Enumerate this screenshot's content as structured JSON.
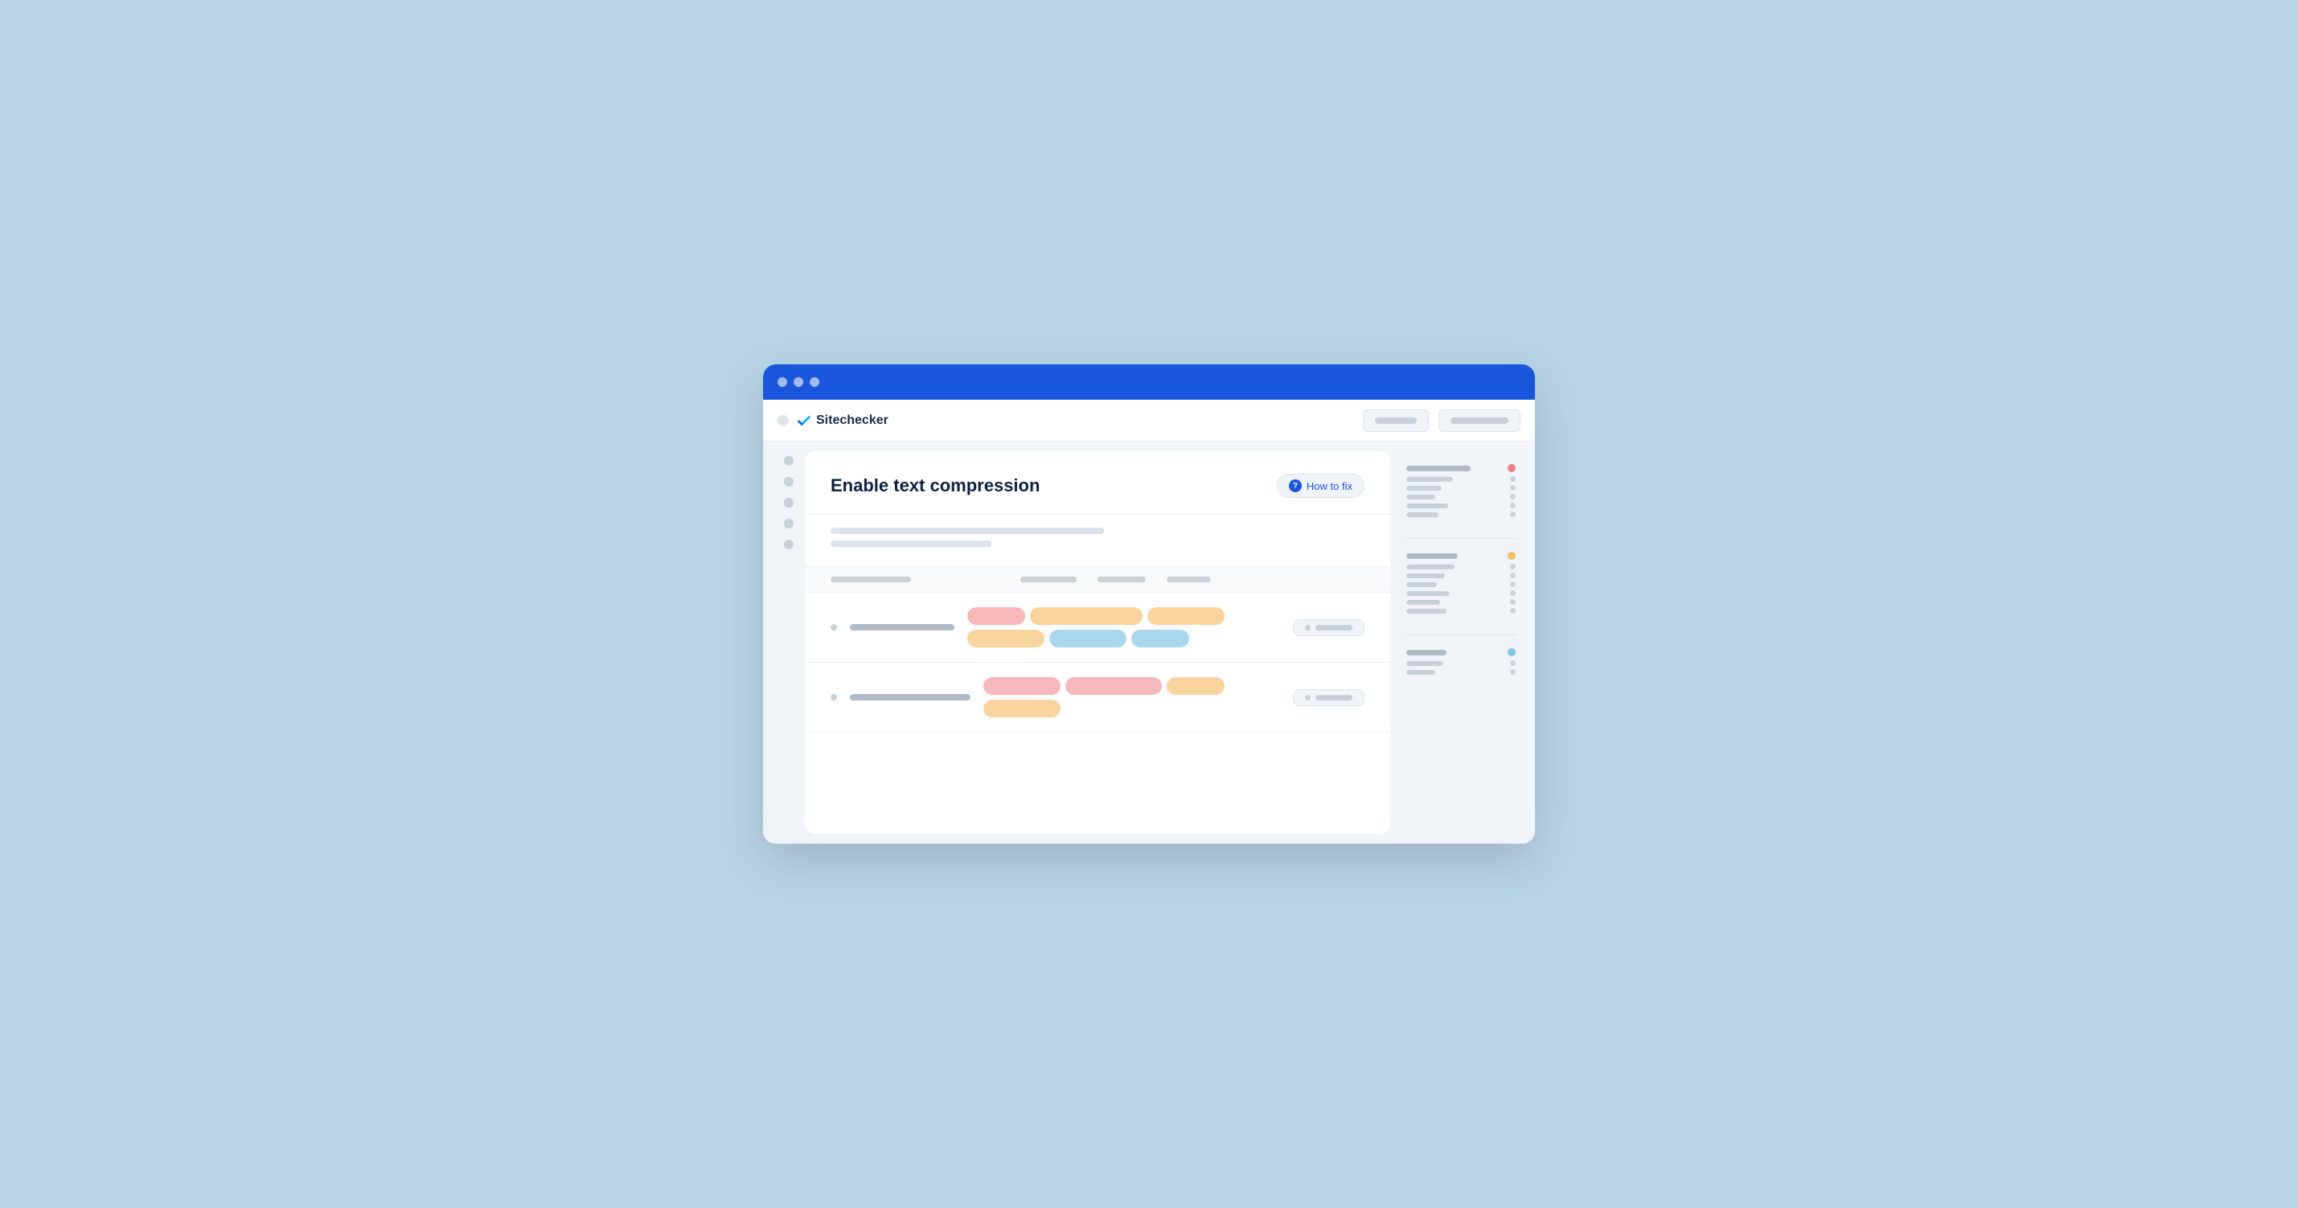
{
  "browser": {
    "traffic_lights": [
      "close",
      "minimize",
      "maximize"
    ],
    "logo_text": "Sitechecker",
    "toolbar_btn1_label": "",
    "toolbar_btn2_label": ""
  },
  "main_content": {
    "title": "Enable text compression",
    "how_to_fix_label": "How to fix",
    "description_line1": "",
    "description_line2": "",
    "rows": [
      {
        "id": "row1",
        "tags": [
          {
            "color": "pink",
            "size": "sm"
          },
          {
            "color": "orange",
            "size": "xl"
          },
          {
            "color": "orange",
            "size": "md"
          },
          {
            "color": "orange",
            "size": "md"
          },
          {
            "color": "blue",
            "size": "md"
          },
          {
            "color": "blue",
            "size": "sm"
          }
        ]
      },
      {
        "id": "row2",
        "tags": [
          {
            "color": "pink",
            "size": "md"
          },
          {
            "color": "pink",
            "size": "lg"
          },
          {
            "color": "orange",
            "size": "sm"
          },
          {
            "color": "orange",
            "size": "md"
          }
        ]
      }
    ]
  },
  "right_panel": {
    "sections": [
      {
        "header_bar": "lg",
        "dot_color": "red",
        "sub_rows": [
          {
            "bar": "md"
          },
          {
            "bar": "sm"
          },
          {
            "bar": "xs"
          },
          {
            "bar": "md"
          },
          {
            "bar": "sm"
          }
        ]
      },
      {
        "header_bar": "md",
        "dot_color": "orange",
        "sub_rows": [
          {
            "bar": "lg"
          },
          {
            "bar": "md"
          },
          {
            "bar": "sm"
          },
          {
            "bar": "xs"
          },
          {
            "bar": "md"
          },
          {
            "bar": "sm"
          }
        ]
      },
      {
        "header_bar": "sm",
        "dot_color": "blue",
        "sub_rows": [
          {
            "bar": "md"
          },
          {
            "bar": "sm"
          }
        ]
      }
    ]
  }
}
